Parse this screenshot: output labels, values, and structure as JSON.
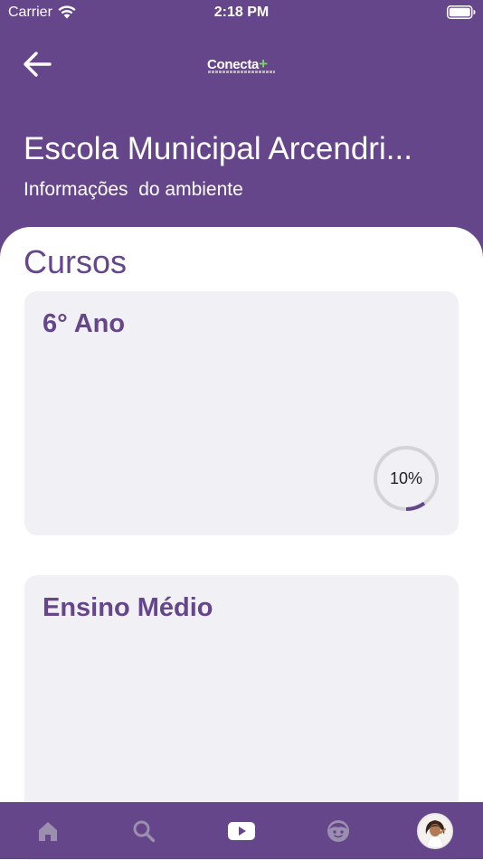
{
  "status_bar": {
    "carrier": "Carrier",
    "time": "2:18 PM",
    "wifi_icon": "wifi-icon",
    "battery_icon": "battery-full-icon"
  },
  "header": {
    "back_icon": "arrow-left-icon",
    "logo": {
      "text": "Conecta",
      "plus": "+"
    },
    "school_name": "Escola Municipal Arcendri...",
    "subtitle": "Informações  do ambiente"
  },
  "courses": {
    "section_title": "Cursos",
    "items": [
      {
        "title": "6° Ano",
        "progress_label": "10%",
        "progress": 0.1
      },
      {
        "title": "Ensino Médio"
      }
    ]
  },
  "tab_bar": {
    "items": [
      {
        "icon": "home-icon",
        "active": false
      },
      {
        "icon": "search-icon",
        "active": false
      },
      {
        "icon": "play-icon",
        "active": true
      },
      {
        "icon": "kid-face-icon",
        "active": false
      },
      {
        "icon": "avatar",
        "active": false
      }
    ]
  },
  "colors": {
    "brand_purple": "#66468a",
    "card_background": "#f1f0f5",
    "progress_track": "#d4d4d8",
    "logo_accent": "#7fd06a",
    "inactive_icon": "#9b8fb0"
  }
}
